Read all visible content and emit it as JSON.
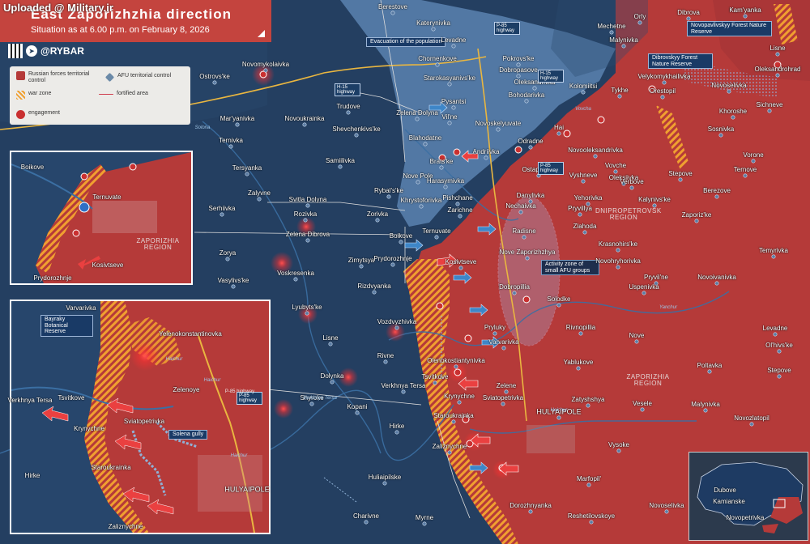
{
  "uploaded_note": "Uploaded @ Military.ir",
  "title": "East Zaporizhzhia direction",
  "subtitle": "Situation as at 6.00 p.m. on February 8, 2026",
  "brand": "@RYBAR",
  "legend": {
    "rf_territory": "Russian forces territorial control",
    "afu_territory": "AFU territorial control",
    "war_zone": "war zone",
    "fortified": "fortified area",
    "engagement": "engagement"
  },
  "colors": {
    "rf": "#b53a39",
    "afu": "#1f3b5c",
    "afu_region_fill": "#5b83b0",
    "war_zone": "#f0a030",
    "engagement": "#c93030",
    "arrow_afu": "#3e86c8",
    "highway": "#e9b640"
  },
  "callouts": {
    "evacuation": "Evacuation of the population",
    "activity": "Activity zone of small AFU groups",
    "forest_1": "Novopavlivskyy Forest Nature Reserve",
    "forest_2": "Dibrovskyy Forest Nature Reserve",
    "bayraky": "Bayraky Botanical Reserve",
    "solena": "Solena gully"
  },
  "regions": {
    "dnipro": "DNIPROPETROVSK REGION",
    "zap_main": "ZAPORIZHIA REGION",
    "zap_inset": "ZAPORIZHIA REGION"
  },
  "rivers": [
    "Solona",
    "Vovcha",
    "Verkhnya Tersa",
    "Haichur",
    "Yanchur",
    "Haichur"
  ],
  "highways": [
    "P-85 highway",
    "H-15 highway",
    "H-15 highway",
    "P-85 highway",
    "P-85 highway"
  ],
  "places": [
    "Berestove",
    "Katerynivka",
    "Levadne",
    "Chornenkove",
    "Pokrovs'ke",
    "Dobropasove",
    "Starokasyanivs'ke",
    "Oleksandrivka",
    "Kolomiitsi",
    "Pysantsi",
    "Bohodarivka",
    "Orly",
    "Mechetne",
    "Malynivka",
    "Dibrova",
    "Kam'yanka",
    "Lisne",
    "Oleksandrohrad",
    "Velykomykhailivka",
    "Tykhe",
    "Orestopil",
    "Novoselivka",
    "Khoroshe",
    "Sichneve",
    "Novomykolaivka",
    "Ostrovs'ke",
    "Trudove",
    "Mar'yanivka",
    "Novoukrainka",
    "Shevchenkivs'ke",
    "Zelena Dolyna",
    "Vil'ne",
    "Novoskelyuvate",
    "Blahodatne",
    "Hai",
    "Odradne",
    "Novooleksandrivka",
    "Ternivka",
    "Samiilivka",
    "Andriivka",
    "Brats'ke",
    "Ostapivs'ke",
    "Vovche",
    "Oleksiivka",
    "Sosnivka",
    "Vorone",
    "Tersyanka",
    "Nove Pole",
    "Rybal's'ke",
    "Harasymivka",
    "Khrystoforivka",
    "Pishchane",
    "Vyshneve",
    "Verbove",
    "Stepove",
    "Ternove",
    "Zalyvne",
    "Svitla Dolyna",
    "Danylivka",
    "Yehorivka",
    "Kalynivs'ke",
    "Berezove",
    "Serhiivka",
    "Rozivka",
    "Zorivka",
    "Zarichne",
    "Nechaivka",
    "Pryvillya",
    "Zaporiz'ke",
    "Zlahoda",
    "Zelena Dibrova",
    "Boikove",
    "Ternuvate",
    "Radisne",
    "Krasnohirs'ke",
    "Temyrivka",
    "Zorya",
    "Zirnytsya",
    "Prydorozhnje",
    "Kosivtseve",
    "Nove Zaporizhzhya",
    "Novohryhorivka",
    "Voskresenka",
    "Vasylivs'ke",
    "Rizdvyanka",
    "Dobropillia",
    "Novoivanivka",
    "Pryvil'ne",
    "Uspenivka",
    "Lyubyts'ke",
    "Solodke",
    "Vozdvyzhivka",
    "Pryluky",
    "Rivnopillia",
    "Nove",
    "Levadne",
    "Ol'hivs'ke",
    "Lisne",
    "Varvarivka",
    "Rivne",
    "Olenokostiantynivka",
    "Yablukove",
    "Poltavka",
    "Dolynka",
    "Verkhnya Tersa",
    "Tsvitkove",
    "Zelene",
    "Stepove",
    "Shyroke",
    "Kopani",
    "Krynychne",
    "Sviatopetrivka",
    "Zatyshshya",
    "Vesele",
    "Malynivka",
    "Hirke",
    "Staroukrainka",
    "HULYAIPOLE",
    "Vysoke",
    "Novozlatopil",
    "Zaliznychne",
    "Huliaipilske",
    "Marfopil'",
    "Charivne",
    "Myrne",
    "Dorozhnyanka",
    "Reshetilovskoye",
    "Novoselivka",
    "Dubove",
    "Kamianske",
    "Novopetrivka"
  ],
  "inset_top_places": [
    "Boikove",
    "Ternuvate",
    "Prydorozhnje",
    "Kosivtseve"
  ],
  "inset_bottom_places": [
    "Varvarivka",
    "Yelenokonstantinovka",
    "Verkhnya Tersa",
    "Tsvitkove",
    "Krynychne",
    "Sviatopetrivka",
    "Zelenoye",
    "Staroukrainka",
    "HULYAIPOLE",
    "Hirke",
    "Zaliznychne"
  ],
  "inset_bottom_extra": [
    "Haichur",
    "P-85 highway",
    "Haichur"
  ]
}
